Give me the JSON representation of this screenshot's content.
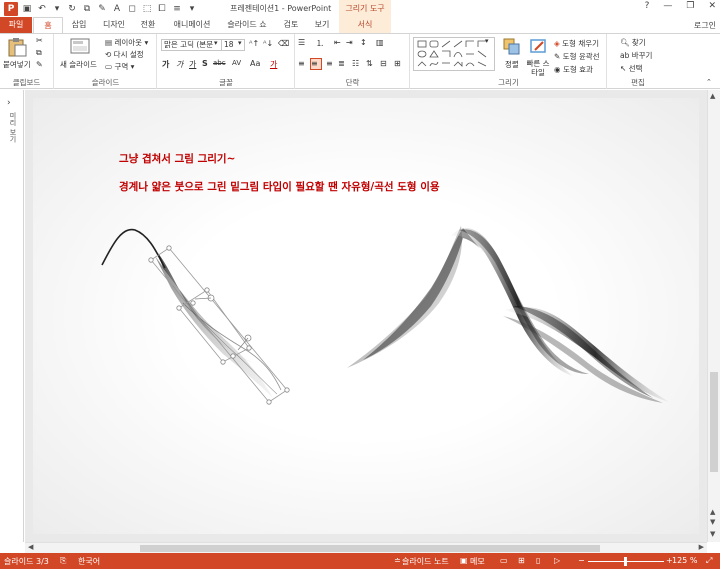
{
  "title_bar": {
    "doc_title": "프레젠테이션1 - PowerPoint",
    "context_tab_header": "그리기 도구",
    "controls": [
      "?",
      "—",
      "❐",
      "✕"
    ]
  },
  "tabs": {
    "file": "파일",
    "items": [
      "홈",
      "삽입",
      "디자인",
      "전환",
      "애니메이션",
      "슬라이드 쇼",
      "검토",
      "보기"
    ],
    "format": "서식",
    "active": "홈",
    "login": "로그인"
  },
  "ribbon": {
    "clipboard": {
      "label": "클립보드",
      "paste": "붙여넣기"
    },
    "slides": {
      "label": "슬라이드",
      "new_slide": "새 슬라이드",
      "layout": "레이아웃",
      "reset": "다시 설정",
      "section": "구역"
    },
    "font": {
      "label": "글꼴",
      "font_name": "맑은 고딕 (본문",
      "font_size": "18",
      "bold": "가",
      "italic": "가",
      "underline": "가",
      "shadow": "S",
      "strike": "abc",
      "spacing": "AV",
      "case": "Aa",
      "color": "가"
    },
    "paragraph": {
      "label": "단락"
    },
    "drawing": {
      "label": "그리기",
      "arrange": "정렬",
      "quick_styles": "빠른 스타일",
      "fill": "도형 채우기",
      "outline": "도형 윤곽선",
      "effects": "도형 효과"
    },
    "editing": {
      "label": "편집",
      "find": "찾기",
      "replace": "바꾸기",
      "select": "선택"
    }
  },
  "left_pane": {
    "label": "미리 보기"
  },
  "slide": {
    "text1": "그냥 겹쳐서 그림 그리기~",
    "text2": "경계나 얇은 붓으로 그린 밑그림 타입이 필요할 땐 자유형/곡선 도형 이용"
  },
  "status_bar": {
    "slide_info": "슬라이드 3/3",
    "language": "한국어",
    "notes": "슬라이드 노트",
    "comments": "메모",
    "zoom": "125 %"
  },
  "colors": {
    "accent": "#d24726",
    "slide_text": "#c00000"
  }
}
